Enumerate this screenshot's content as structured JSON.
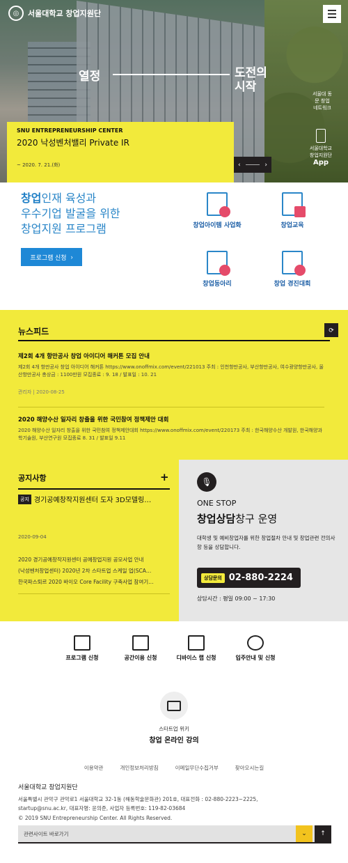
{
  "header": {
    "logo_text": "서울대학교 창업지원단",
    "menu_icon": "hamburger-icon"
  },
  "hero": {
    "slogan_left": "열정",
    "slogan_right_1": "도전의",
    "slogan_right_2": "시작",
    "side_network": "서울대 동문 창업 네트워크",
    "side_app_line1": "서울대학교",
    "side_app_line2": "창업지원단",
    "side_app_label": "App",
    "card_eyebrow": "SNU ENTREPRENEURSHIP CENTER",
    "card_title": "2020 낙성벤처밸리 Private IR",
    "card_date": "~ 2020. 7. 21.(화)",
    "prev_icon": "‹",
    "next_icon": "›"
  },
  "program": {
    "title_accent": "창업",
    "title_rest1": "인재 육성과",
    "title_line2": "우수기업 발굴을 위한",
    "title_line3": "창업지원 프로그램",
    "button_label": "프로그램 신청",
    "items": [
      {
        "label": "창업아이템 사업화"
      },
      {
        "label": "창업교육"
      },
      {
        "label": "창업동아리"
      },
      {
        "label": "창업 경진대회"
      }
    ]
  },
  "news": {
    "heading": "뉴스피드",
    "items": [
      {
        "title": "제2회 4개 항만공사 창업 아이디어 해커톤 모집 안내",
        "desc": "제2회 4개 항만공사 창업 아이디어 해커톤 https://www.onoffmix.com/event/221013 주최 : 인천항만공사, 부산항만공사, 여수광양항만공사, 울산항만공사 총상금 : 1100만원 모집종료 : 9. 18 / 발표일 : 10. 21",
        "meta": "관리자 | 2020-08-25"
      },
      {
        "title": "2020 해양수산 일자리 창출을 위한 국민참여 정책제안 대회",
        "desc": "2020 해양수산 일자리 창출을 위한 국민참여 정책제안대회 https://www.onoffmix.com/event/220173 주최 : 한국해양수산 개발원, 한국해양과학기술원, 부산연구원 모집종료 8. 31 / 발표일 9.11",
        "meta": ""
      }
    ]
  },
  "notice": {
    "heading_bold": "공지",
    "heading_rest": "사항",
    "plus": "+",
    "tag": "공지",
    "featured": "경기공예창작지원센터 도자 3D모델링…",
    "date": "2020-09-04",
    "list": [
      "2020 경기공예창작지원센터 공예창업지원 공모사업 안내",
      "(낙성벤처창업센터) 2020년 2차 스타트업 스케일 업(SCA…",
      "한국파스퇴르 2020 바이오 Core Facility 구축사업 참여기…"
    ]
  },
  "onestop": {
    "eyebrow": "ONE STOP",
    "title_bold": "창업상담",
    "title_rest": "창구 운영",
    "desc": "대학생 및 예비창업자를 위한 창업절차 안내 및 창업관련 전의사항 등을 상담합니다.",
    "call_label": "상담문의",
    "phone": "02-880-2224",
    "hours": "상담시간 : 평일 09:00 ~ 17:30"
  },
  "quick": [
    {
      "label": "프로그램 신청",
      "icon": "calendar-clock-icon"
    },
    {
      "label": "공간이용 신청",
      "icon": "building-icon"
    },
    {
      "label": "디바이스 랩 신청",
      "icon": "briefcase-icon"
    },
    {
      "label": "입주안내 및 신청",
      "icon": "person-icon"
    }
  ],
  "lecture": {
    "sub": "스타트업 위키",
    "main": "창업 온라인 강의"
  },
  "footer": {
    "links": [
      "이용약관",
      "개인정보처리방침",
      "이메일무단수집거부",
      "찾아오시는길"
    ],
    "org": "서울대학교 창업지원단",
    "addr1": "서울특별시 관악구 관악로1 서울대학교 32-1동 (해동학술문화관) 201호, 대표전화 : 02-880-2223~2225,",
    "addr2": "startup@snu.ac.kr, 대표자명: 윤의준, 사업자 등록번호: 119-82-03684",
    "copyright": "© 2019 SNU Entrepreneurship Center. All Rights Reserved.",
    "related_label": "관련사이트 바로가기",
    "dropdown_icon": "⌄",
    "top_icon": "↑"
  }
}
